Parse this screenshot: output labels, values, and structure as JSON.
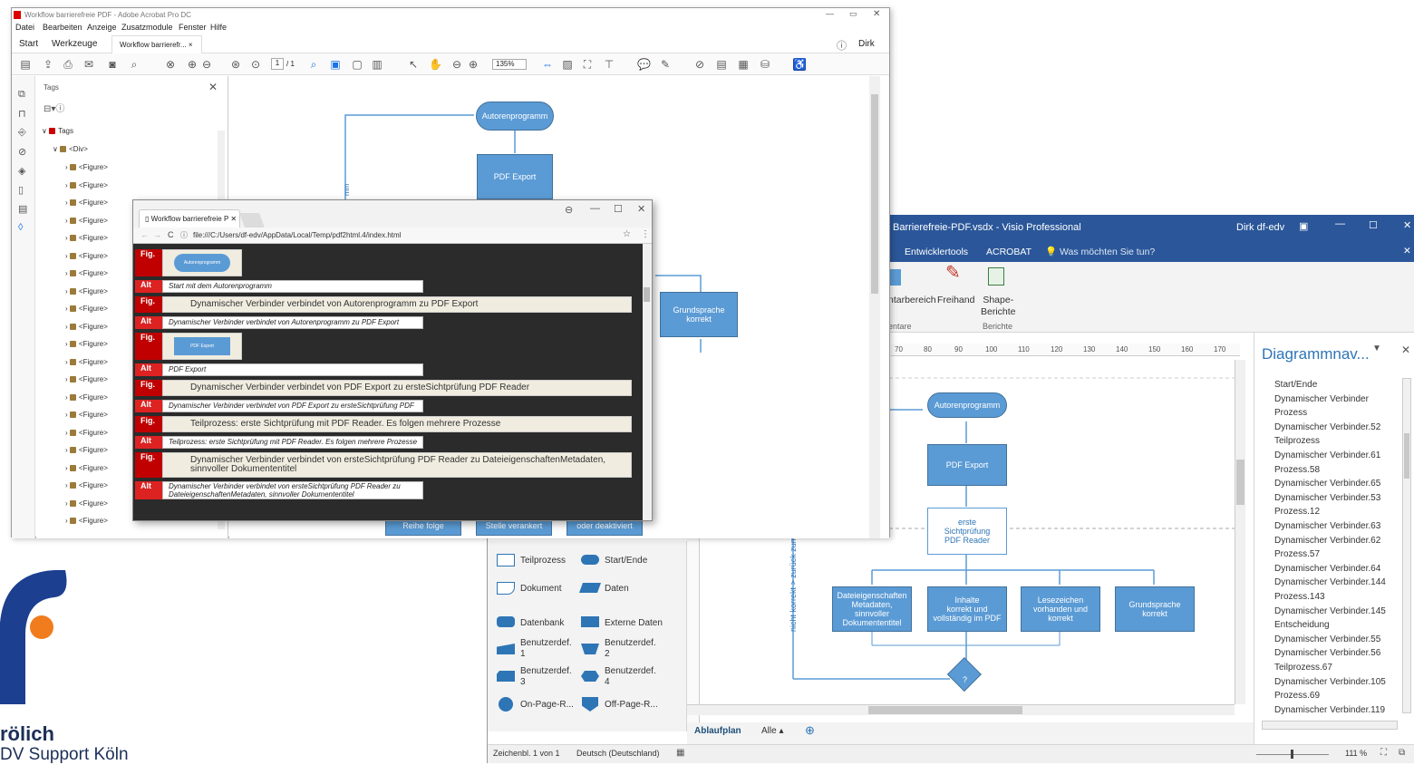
{
  "brand": {
    "name_partial": "rölich",
    "sub_partial": "DV Support Köln",
    "logo_colors": {
      "blue": "#1c3f8f",
      "orange": "#f07c1e"
    }
  },
  "visio": {
    "title": "Barrierefreie-PDF.vsdx  -  Visio Professional",
    "user": "Dirk df-edv",
    "menu": [
      "Entwicklertools",
      "ACROBAT"
    ],
    "search_hint": "Was möchten Sie tun?",
    "ribbon": {
      "item1": "ntarbereich",
      "freehand": "Freihand",
      "shape_reports": "Shape-\nBerichte",
      "group1": "entare",
      "group2": "Berichte"
    },
    "ruler": [
      "70",
      "80",
      "90",
      "100",
      "110",
      "120",
      "130",
      "140",
      "150",
      "160",
      "170"
    ],
    "shapes": [
      {
        "label": "Teilprozess"
      },
      {
        "label": "Start/Ende"
      },
      {
        "label": "Dokument"
      },
      {
        "label": "Daten"
      },
      {
        "label": "Datenbank"
      },
      {
        "label": "Externe Daten"
      },
      {
        "label": "Benutzerdef.\n1"
      },
      {
        "label": "Benutzerdef.\n2"
      },
      {
        "label": "Benutzerdef.\n3"
      },
      {
        "label": "Benutzerdef.\n4"
      },
      {
        "label": "On-Page-R..."
      },
      {
        "label": "Off-Page-R..."
      }
    ],
    "tabs": {
      "active": "Ablaufplan",
      "all": "Alle ▴"
    },
    "status": {
      "page": "Zeichenbl. 1 von 1",
      "lang": "Deutsch (Deutschland)",
      "zoom": "111 %"
    },
    "nav_title": "Diagrammnav...",
    "nav_items": [
      "Start/Ende",
      "Dynamischer Verbinder",
      "Prozess",
      "Dynamischer Verbinder.52",
      "Teilprozess",
      "Dynamischer Verbinder.61",
      "Prozess.58",
      "Dynamischer Verbinder.65",
      "Dynamischer Verbinder.53",
      "Prozess.12",
      "Dynamischer Verbinder.63",
      "Dynamischer Verbinder.62",
      "Prozess.57",
      "Dynamischer Verbinder.64",
      "Dynamischer Verbinder.144",
      "Prozess.143",
      "Dynamischer Verbinder.145",
      "Entscheidung",
      "Dynamischer Verbinder.55",
      "Dynamischer Verbinder.56",
      "Teilprozess.67",
      "Dynamischer Verbinder.105",
      "Prozess.69",
      "Dynamischer Verbinder.119"
    ],
    "diagram": {
      "start": "Autorenprogramm",
      "export": "PDF Export",
      "check": "erste\nSichtprüfung\nPDF Reader",
      "b1": "Dateieigenschaften\nMetadaten,\nsinnvoller\nDokumententitel",
      "b2": "Inhalte\nkorrekt und\nvollständig im PDF",
      "b3": "Lesezeichen\nvorhanden und\nkorrekt",
      "b4": "Grundsprache\nkorrekt",
      "decision": "?",
      "side": "nicht korrekt > zurück zum A"
    }
  },
  "acrobat": {
    "title": "Workflow barrierefreie PDF - Adobe Acrobat Pro DC",
    "menu": [
      "Datei",
      "Bearbeiten",
      "Anzeige",
      "Zusatzmodule",
      "Fenster",
      "Hilfe"
    ],
    "tabs": [
      "Start",
      "Werkzeuge",
      "Workflow barrierefr... ×"
    ],
    "user": "Dirk",
    "page": "1",
    "page_total": "/ 1",
    "zoom": "135%",
    "panel_title": "Tags",
    "tag_root": "Tags",
    "tag_div": "<Div>",
    "figure": "<Figure>",
    "doc": {
      "start": "Autorenprogramm",
      "export": "PDF Export",
      "lang": "Grundsprache\nkorrekt",
      "b1": "Reihe folge",
      "b2": "Stelle verankert",
      "b3": "oder deaktiviert",
      "side": "mm"
    }
  },
  "browser": {
    "tab": "Workflow barrierefreie P",
    "url": "file:///C:/Users/df-edv/AppData/Local/Temp/pdf2html.4/index.html",
    "rows": [
      {
        "kind": "Fig.",
        "text": "",
        "thumb": "Autorenprogramm"
      },
      {
        "kind": "Alt",
        "text": "Start mit dem Autorenprogramm"
      },
      {
        "kind": "Fig.",
        "text": "Dynamischer Verbinder verbindet von Autorenprogramm zu PDF Export"
      },
      {
        "kind": "Alt",
        "text": "Dynamischer Verbinder verbindet von Autorenprogramm zu PDF Export"
      },
      {
        "kind": "Fig.",
        "text": "",
        "thumb": "PDF Export"
      },
      {
        "kind": "Alt",
        "text": "PDF Export"
      },
      {
        "kind": "Fig.",
        "text": "Dynamischer Verbinder verbindet von PDF Export zu ersteSichtprüfung PDF Reader"
      },
      {
        "kind": "Alt",
        "text": "Dynamischer Verbinder verbindet von PDF Export zu ersteSichtprüfung PDF Reader"
      },
      {
        "kind": "Fig.",
        "text": "Teilprozess: erste Sichtprüfung mit PDF Reader. Es folgen mehrere Prozesse"
      },
      {
        "kind": "Alt",
        "text": "Teilprozess: erste Sichtprüfung mit PDF Reader. Es folgen mehrere Prozesse"
      },
      {
        "kind": "Fig.",
        "text": "Dynamischer Verbinder verbindet von ersteSichtprüfung PDF Reader zu DateieigenschaftenMetadaten, sinnvoller Dokumententitel"
      },
      {
        "kind": "Alt",
        "text": "Dynamischer Verbinder verbindet von ersteSichtprüfung PDF Reader zu DateieigenschaftenMetadaten, sinnvoller Dokumententitel"
      }
    ]
  }
}
